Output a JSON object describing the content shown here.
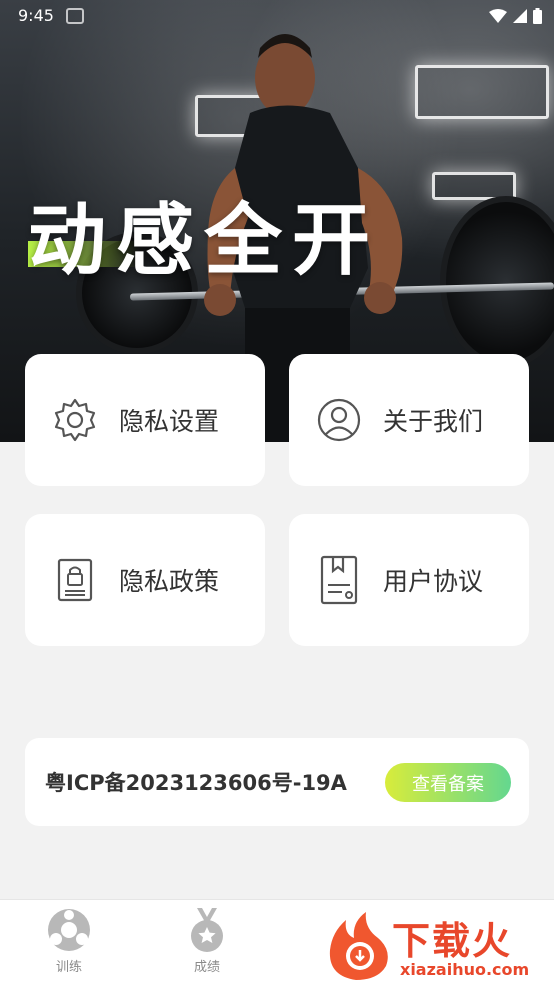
{
  "status_bar": {
    "time": "9:45"
  },
  "hero": {
    "title": "动感全开"
  },
  "cards": {
    "privacy_settings": "隐私设置",
    "about_us": "关于我们",
    "privacy_policy": "隐私政策",
    "user_agreement": "用户协议"
  },
  "icp": {
    "text": "粤ICP备2023123606号-19A",
    "button": "查看备案"
  },
  "nav": {
    "training": "训练",
    "achievements": "成绩"
  },
  "watermark": {
    "text": "下载火",
    "url": "xiazaihuo.com"
  },
  "colors": {
    "accent_green": "#b7f046",
    "button_start": "#d8ec3b",
    "button_end": "#64d78f",
    "watermark_red": "#e8472b"
  }
}
